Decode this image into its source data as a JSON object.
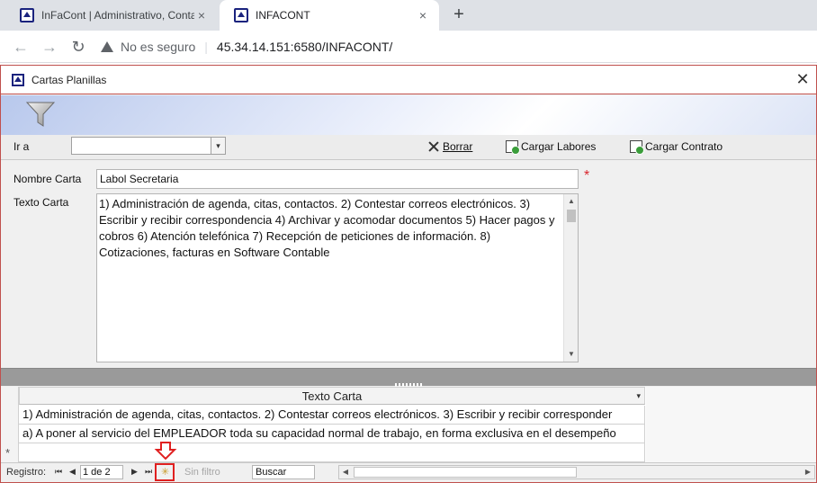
{
  "browser": {
    "tabs": [
      {
        "title": "InFaCont | Administrativo, Contab",
        "close": "×"
      },
      {
        "title": "INFACONT",
        "close": "×"
      }
    ],
    "new_tab": "+",
    "nav": {
      "back": "←",
      "forward": "→",
      "reload": "↻"
    },
    "security_text": "No es seguro",
    "url_separator": "|",
    "url": "45.34.14.151:6580/INFACONT/"
  },
  "window": {
    "title": "Cartas Planillas",
    "close": "✕"
  },
  "filterbar": {
    "goto_label": "Ir a",
    "goto_value": "",
    "goto_arrow": "▾",
    "delete_label": "Borrar",
    "load_labores_label": "Cargar Labores",
    "load_contract_label": "Cargar Contrato"
  },
  "form": {
    "name_label": "Nombre Carta",
    "name_value": "Labol Secretaria",
    "required_mark": "*",
    "text_label": "Texto Carta",
    "text_value": "1) Administración de agenda, citas, contactos. 2) Contestar correos electrónicos. 3) Escribir y recibir correspondencia 4) Archivar y acomodar documentos 5) Hacer pagos y cobros 6) Atención telefónica 7) Recepción de peticiones de información. 8) Cotizaciones, facturas en Software Contable",
    "scroll_up": "▲",
    "scroll_down": "▼"
  },
  "datasheet": {
    "column_header": "Texto Carta",
    "sort_glyph": "▾",
    "rows": [
      "1) Administración de agenda, citas, contactos. 2) Contestar correos electrónicos. 3) Escribir y recibir corresponder",
      "a) A poner al servicio del EMPLEADOR toda su capacidad normal de trabajo, en forma exclusiva en el desempeño"
    ],
    "new_row_mark": "*"
  },
  "navigation": {
    "label": "Registro:",
    "first": "⏮",
    "prev": "◀",
    "record": "1 de 2",
    "next": "▶",
    "last": "⏭",
    "new_record": "✳",
    "no_filter": "Sin filtro",
    "search_value": "Buscar",
    "scroll_left": "◀",
    "scroll_right": "▶"
  },
  "colors": {
    "accent_red": "#e02020",
    "window_border": "#c0504d",
    "required": "#d9262d"
  }
}
